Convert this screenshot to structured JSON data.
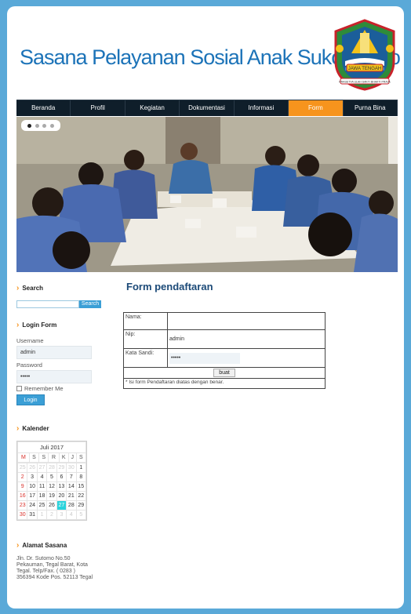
{
  "header": {
    "title": "Sasana Pelayanan Sosial Anak Suko Mulyo Tegal",
    "logo_text": "JAWA TENGAH",
    "logo_motto": "PRASETYA ULAH SAKTI BHAKTI PRAJA"
  },
  "nav": {
    "items": [
      "Beranda",
      "Profil",
      "Kegiatan",
      "Dokumentasi",
      "Informasi",
      "Form",
      "Purna Bina"
    ],
    "active": "Form"
  },
  "sidebar": {
    "search": {
      "heading": "Search",
      "button": "Search",
      "value": ""
    },
    "login": {
      "heading": "Login Form",
      "username_label": "Username",
      "username_value": "admin",
      "password_label": "Password",
      "password_value": "•••••",
      "remember_label": "Remember Me",
      "login_button": "Login"
    },
    "calendar": {
      "heading": "Kalender",
      "month": "Juli 2017",
      "weekdays": [
        "M",
        "S",
        "S",
        "R",
        "K",
        "J",
        "S"
      ],
      "weeks": [
        [
          "25",
          "26",
          "27",
          "28",
          "29",
          "30",
          "1"
        ],
        [
          "2",
          "3",
          "4",
          "5",
          "6",
          "7",
          "8"
        ],
        [
          "9",
          "10",
          "11",
          "12",
          "13",
          "14",
          "15"
        ],
        [
          "16",
          "17",
          "18",
          "19",
          "20",
          "21",
          "22"
        ],
        [
          "23",
          "24",
          "25",
          "26",
          "27",
          "28",
          "29"
        ],
        [
          "30",
          "31",
          "1",
          "2",
          "3",
          "4",
          "5"
        ]
      ],
      "today": "27"
    },
    "address": {
      "heading": "Alamat Sasana",
      "text": "Jln. Dr. Sutomo No.50 Pekauman, Tegal Barat, Kota Tegal. Telp/Fax. ( 0283 ) 356394 Kode Pos. 52113 Tegal"
    }
  },
  "form": {
    "title": "Form pendaftaran",
    "name_label": "Nama:",
    "name_value": "",
    "nip_label": "Nip:",
    "nip_value": "admin",
    "password_label": "Kata Sandi:",
    "password_value": "•••••",
    "submit": "buat",
    "note": "* Isi form Pendaftaran diatas dengan benar."
  },
  "colors": {
    "accent": "#f7941d",
    "brand": "#1c73b8",
    "background": "#5aa9d8",
    "nav": "#0f1e2a",
    "today": "#2ad3dc"
  }
}
